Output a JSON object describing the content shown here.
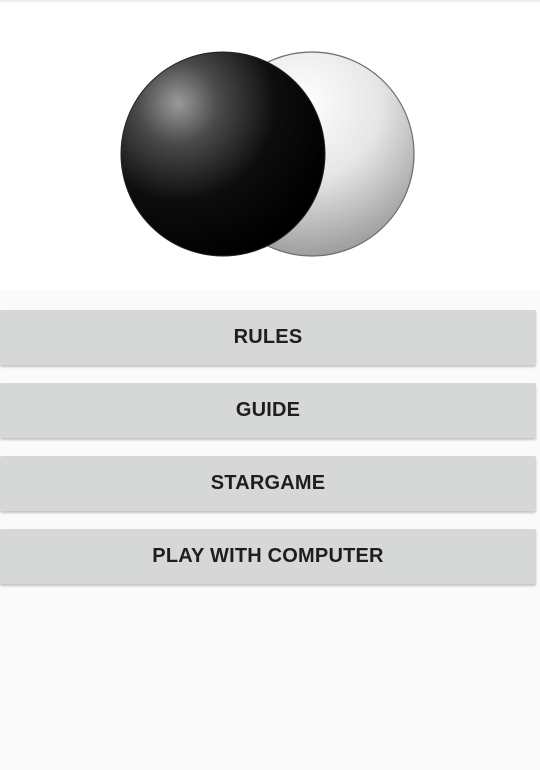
{
  "logo": {
    "icon": "black-white-stones-logo-icon",
    "colors": {
      "black_stone": "#000000",
      "white_stone": "#f2f2f2"
    }
  },
  "menu": {
    "buttons": [
      {
        "label": "RULES"
      },
      {
        "label": "GUIDE"
      },
      {
        "label": "STARGAME"
      },
      {
        "label": "PLAY WITH COMPUTER"
      }
    ],
    "button_color": "#d6d7d7",
    "text_color": "#1e1e1e"
  }
}
